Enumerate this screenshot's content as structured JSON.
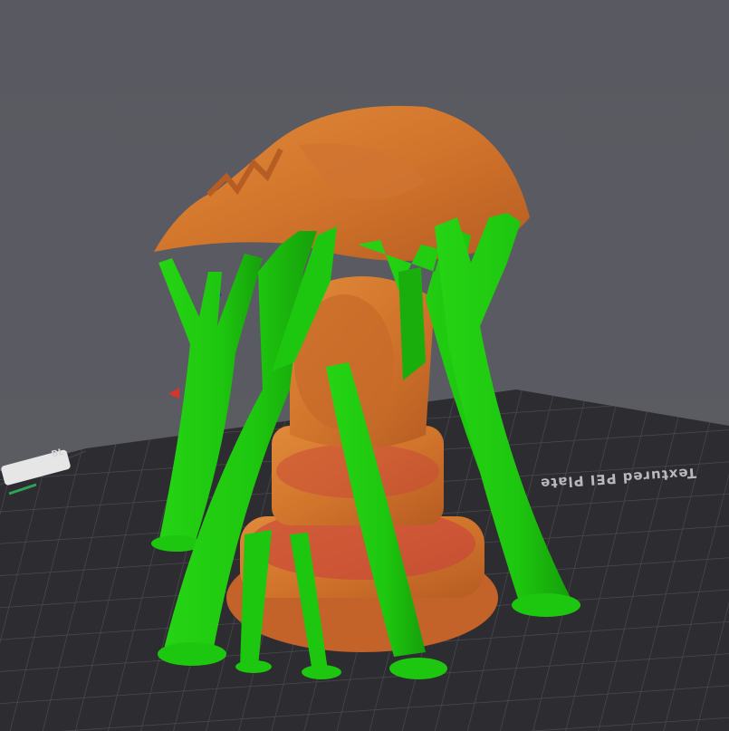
{
  "scene": {
    "plate_label": "Textured PEI Plate",
    "plate_logo_text": "BL",
    "colors": {
      "background": "#5a5a61",
      "plate": "#2d2d31",
      "grid": "#47474c",
      "model_orange": "#d4772c",
      "model_red": "#c9453a",
      "support_green": "#1ec70f",
      "support_green_dark": "#17a00b"
    },
    "icons": [
      "print-bed",
      "bed-logo",
      "axis-origin-arrow",
      "axis-z-marker"
    ]
  }
}
